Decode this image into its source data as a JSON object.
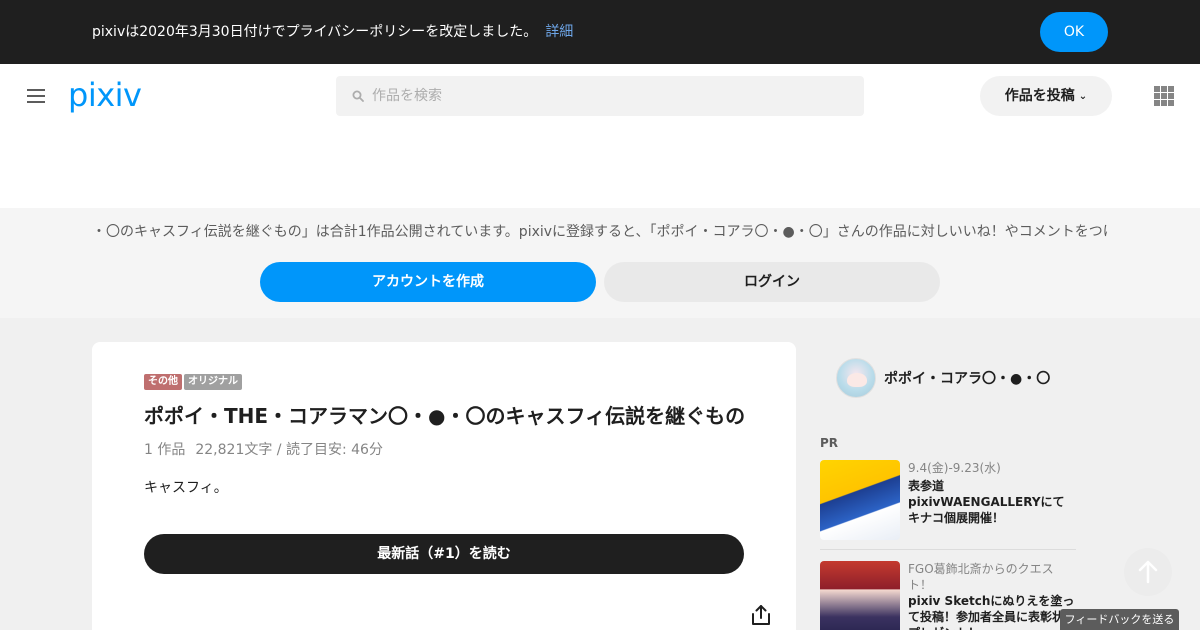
{
  "banner": {
    "text": "pixivは2020年3月30日付けでプライバシーポリシーを改定しました。",
    "link": "詳細",
    "ok": "OK"
  },
  "header": {
    "logo": "pixiv",
    "search_placeholder": "作品を検索",
    "post_button": "作品を投稿"
  },
  "signup": {
    "text": "・〇のキャスフィ伝説を継ぐもの」は合計1作品公開されています。pixivに登録すると、「ポポイ・コアラ〇・●・〇」さんの作品に対しいいね！やコメントをつけ",
    "create_account": "アカウントを作成",
    "login": "ログイン"
  },
  "work": {
    "tags": [
      "その他",
      "オリジナル"
    ],
    "title": "ポポイ・THE・コアラマン〇・●・〇のキャスフィ伝説を継ぐもの",
    "count": "1 作品",
    "stats": "22,821文字 / 読了目安: 46分",
    "caption": "キャスフィ。",
    "read_button": "最新話（#1）を読む"
  },
  "sidebar": {
    "author_name": "ポポイ・コアラ〇・●・〇",
    "pr_label": "PR",
    "ads": [
      {
        "meta": "9.4(金)-9.23(水)",
        "text": "表参道pixivWAENGALLERYにてキナコ個展開催！"
      },
      {
        "meta": "FGO葛飾北斎からのクエスト！",
        "text": "pixiv Sketchにぬりえを塗って投稿！参加者全員に表彰状をプレゼント！"
      }
    ]
  },
  "feedback": "フィードバックを送る",
  "colors": {
    "accent": "#0096fa",
    "banner_bg": "#1f1f1f",
    "tag_genre": "#bf6f6f",
    "tag_original": "#a0a0a0"
  }
}
